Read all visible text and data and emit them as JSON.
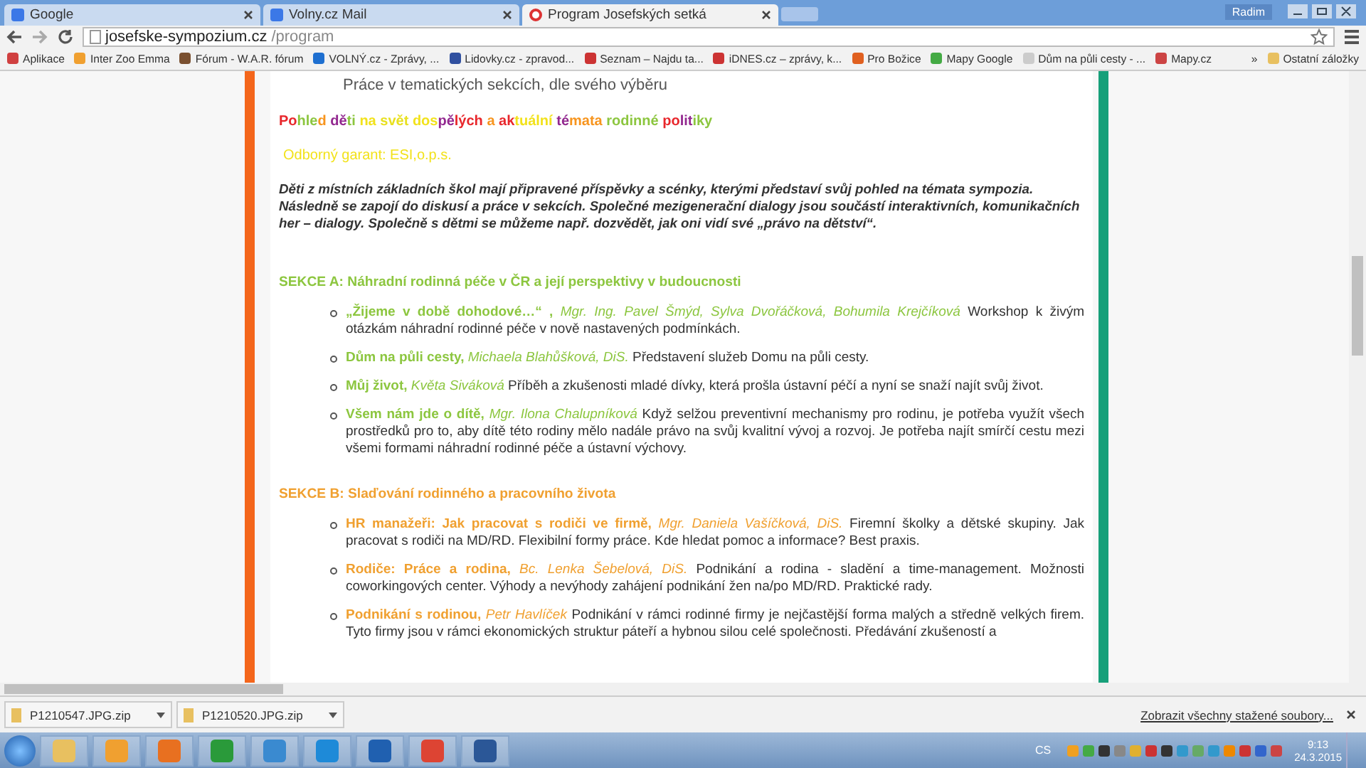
{
  "browser": {
    "tabs": [
      {
        "title": "Google",
        "selected": false
      },
      {
        "title": "Volny.cz Mail",
        "selected": false
      },
      {
        "title": "Program Josefských setká",
        "selected": true
      }
    ],
    "user": "Radim",
    "url": {
      "host": "josefske-sympozium.cz",
      "path": "/program"
    },
    "bookmarks": [
      {
        "label": "Aplikace"
      },
      {
        "label": "Inter Zoo Emma"
      },
      {
        "label": "Fórum - W.A.R. fórum"
      },
      {
        "label": "VOLNÝ.cz - Zprávy, ..."
      },
      {
        "label": "Lidovky.cz - zpravod..."
      },
      {
        "label": "Seznam – Najdu ta..."
      },
      {
        "label": "iDNES.cz – zprávy, k..."
      },
      {
        "label": "Pro Božice"
      },
      {
        "label": "Mapy Google"
      },
      {
        "label": "Dům na půli cesty - ..."
      },
      {
        "label": "Mapy.cz"
      }
    ],
    "bookmarks_more": "»",
    "other_bookmarks": "Ostatní záložky"
  },
  "page": {
    "cut_line": "Práce v tematických sekcích, dle svého výběru",
    "title_segments": [
      {
        "text": "Po",
        "color": "#e8262b"
      },
      {
        "text": "hle",
        "color": "#8cc63f"
      },
      {
        "text": "d ",
        "color": "#f7941d"
      },
      {
        "text": "dě",
        "color": "#92278f"
      },
      {
        "text": "ti ",
        "color": "#8cc63f"
      },
      {
        "text": "na ",
        "color": "#f2e21b"
      },
      {
        "text": "svět ",
        "color": "#e8e020"
      },
      {
        "text": "dos",
        "color": "#f2e21b"
      },
      {
        "text": "pě",
        "color": "#92278f"
      },
      {
        "text": "lých ",
        "color": "#e8262b"
      },
      {
        "text": "a ",
        "color": "#f7941d"
      },
      {
        "text": "ak",
        "color": "#e8262b"
      },
      {
        "text": "tuální ",
        "color": "#f2e21b"
      },
      {
        "text": "té",
        "color": "#92278f"
      },
      {
        "text": "mata ",
        "color": "#f7941d"
      },
      {
        "text": "rodinné ",
        "color": "#8cc63f"
      },
      {
        "text": "po",
        "color": "#e8262b"
      },
      {
        "text": "lit",
        "color": "#92278f"
      },
      {
        "text": "iky",
        "color": "#8cc63f"
      }
    ],
    "guarantor": "Odborný garant: ESI,o.p.s.",
    "intro": "Děti z místních základních škol mají připravené příspěvky a scénky, kterými představí svůj pohled na témata sympozia. Následně se zapojí do diskusí a práce v sekcích. Společné mezigenerační dialogy jsou součástí interaktivních, komunikačních her – dialogy. Společně s dětmi se můžeme např. dozvědět, jak oni vidí své „právo na dětství“.",
    "sections": [
      {
        "heading": "SEKCE A: Náhradní rodinná péče v ČR a její perspektivy v budoucnosti",
        "color": "#8cc63f",
        "items": [
          {
            "title": "„Žijeme v době dohodové…“ ,",
            "authors": "Mgr. Ing. Pavel Šmýd, Sylva Dvořáčková, Bohumila Krejčíková",
            "text": "Workshop k živým otázkám náhradní rodinné péče v nově nastavených podmínkách."
          },
          {
            "title": "Dům na půli cesty,",
            "authors": "Michaela Blahůšková, DiS.",
            "text": "Představení služeb Domu na půli cesty."
          },
          {
            "title": "Můj život,",
            "authors": "Květa Siváková",
            "text": "Příběh a zkušenosti mladé dívky, která prošla ústavní péčí a nyní se snaží najít svůj život."
          },
          {
            "title": "Všem nám jde o dítě,",
            "authors": "Mgr. Ilona Chalupníková",
            "text": "Když selžou preventivní mechanismy pro rodinu, je potřeba využít všech prostředků pro to, aby dítě této rodiny mělo nadále právo na svůj kvalitní vývoj a rozvoj. Je potřeba najít smírčí cestu mezi všemi formami náhradní rodinné péče a ústavní výchovy."
          }
        ]
      },
      {
        "heading": "SEKCE B: Slaďování rodinného a pracovního života",
        "color": "#f0a030",
        "items": [
          {
            "title": "HR manažeři: Jak pracovat s rodiči ve firmě,",
            "authors": "Mgr. Daniela Vašíčková, DiS.",
            "text": "Firemní školky a dětské skupiny. Jak pracovat s rodiči na MD/RD. Flexibilní formy práce. Kde hledat pomoc a informace? Best praxis."
          },
          {
            "title": "Rodiče: Práce a rodina,",
            "authors": "Bc. Lenka Šebelová, DiS.",
            "text": "Podnikání a rodina - sladění a time-management. Možnosti coworkingových center. Výhody a nevýhody zahájení podnikání žen na/po MD/RD. Praktické rady."
          },
          {
            "title": "Podnikání s rodinou,",
            "authors": "Petr Havlíček",
            "text": "Podnikání v rámci rodinné firmy je nejčastější forma malých a středně velkých firem. Tyto firmy jsou v rámci ekonomických struktur páteří a hybnou silou celé společnosti. Předávání zkušeností a"
          }
        ]
      }
    ]
  },
  "downloads": {
    "files": [
      "P1210547.JPG.zip",
      "P1210520.JPG.zip"
    ],
    "show_all": "Zobrazit všechny stažené soubory..."
  },
  "taskbar": {
    "language": "CS",
    "time": "9:13",
    "date": "24.3.2015"
  }
}
